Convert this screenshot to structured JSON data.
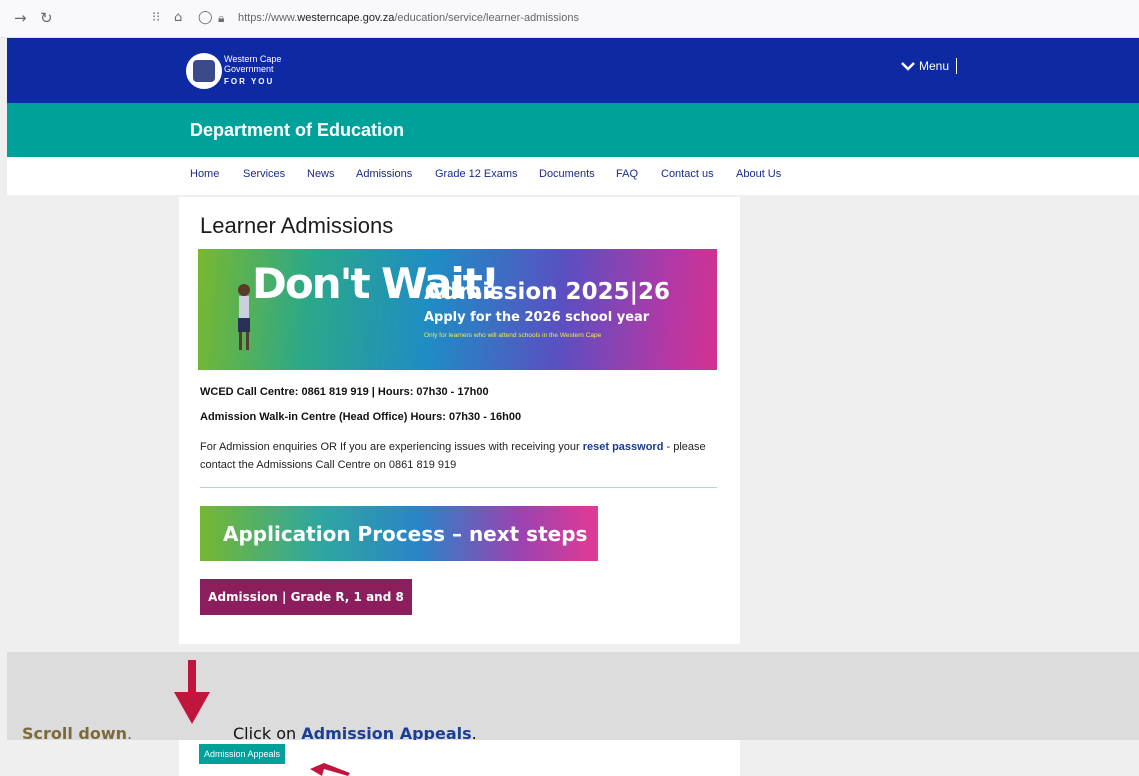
{
  "browser": {
    "url_prefix": "https://www.",
    "url_domain": "westerncape.gov.za",
    "url_path": "/education/service/learner-admissions"
  },
  "header": {
    "logo_line1": "Western Cape",
    "logo_line2": "Government",
    "logo_line3": "FOR YOU",
    "menu_label": "Menu",
    "dept_title": "Department of Education"
  },
  "nav": {
    "items": [
      "Home",
      "Services",
      "News",
      "Admissions",
      "Grade 12 Exams",
      "Documents",
      "FAQ",
      "Contact us",
      "About Us"
    ]
  },
  "content": {
    "page_title": "Learner Admissions",
    "banner": {
      "headline_left": "Don't Wait!",
      "title": "Admission 2025|26",
      "subtitle": "Apply for the 2026 school year",
      "note": "Only for learners who will attend schools in the Western Cape"
    },
    "call_centre": "WCED Call Centre: 0861 819 919 | Hours: 07h30 - 17h00",
    "walk_in": "Admission Walk-in Centre (Head Office) Hours: 07h30 - 16h00",
    "enquiry_before": "For Admission enquiries OR If you are experiencing issues with receiving your ",
    "enquiry_link": "reset password",
    "enquiry_after": " - please contact the Admissions Call Centre on 0861 819 919",
    "process_button": "Application Process – next steps",
    "grade_button": "Admission | Grade R, 1 and 8"
  },
  "instruction": {
    "scroll_label": "Scroll down",
    "scroll_period": ".",
    "click_prefix": "Click on ",
    "click_target": "Admission Appeals",
    "click_period": "."
  },
  "bottom": {
    "appeals_button": "Admission Appeals"
  },
  "colors": {
    "header_blue": "#0e2aa2",
    "dept_teal": "#00a19a",
    "arrow_red": "#c0163c",
    "grade_button": "#8c1e5d"
  }
}
